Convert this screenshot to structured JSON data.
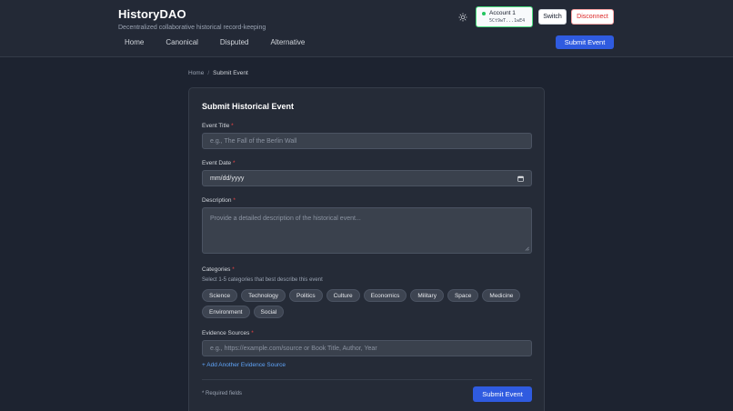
{
  "app": {
    "title": "HistoryDAO",
    "tagline": "Decentralized collaborative historical record-keeping"
  },
  "nav": [
    {
      "label": "Home"
    },
    {
      "label": "Canonical"
    },
    {
      "label": "Disputed"
    },
    {
      "label": "Alternative"
    }
  ],
  "header": {
    "theme_icon": "sun-icon",
    "account_name": "Account 1",
    "account_address": "5Ct9wT...1wE4",
    "switch_label": "Switch",
    "disconnect_label": "Disconnect",
    "submit_label": "Submit Event",
    "connected_color": "#22c55e",
    "accent_color": "#2f5be0"
  },
  "breadcrumb": {
    "home": "Home",
    "separator": "/",
    "current": "Submit Event"
  },
  "form": {
    "title": "Submit Historical Event",
    "required_marker": "*",
    "event_title": {
      "label": "Event Title",
      "placeholder": "e.g., The Fall of the Berlin Wall"
    },
    "event_date": {
      "label": "Event Date",
      "value": "mm/dd/yyyy",
      "icon": "calendar-icon"
    },
    "description": {
      "label": "Description",
      "placeholder": "Provide a detailed description of the historical event..."
    },
    "categories": {
      "label": "Categories",
      "helper": "Select 1-5 categories that best describe this event",
      "options": [
        "Science",
        "Technology",
        "Politics",
        "Culture",
        "Economics",
        "Military",
        "Space",
        "Medicine",
        "Environment",
        "Social"
      ]
    },
    "evidence": {
      "label": "Evidence Sources",
      "placeholder": "e.g., https://example.com/source or Book Title, Author, Year",
      "add_link": "+ Add Another Evidence Source"
    },
    "required_note": "* Required fields",
    "submit_label": "Submit Event"
  }
}
